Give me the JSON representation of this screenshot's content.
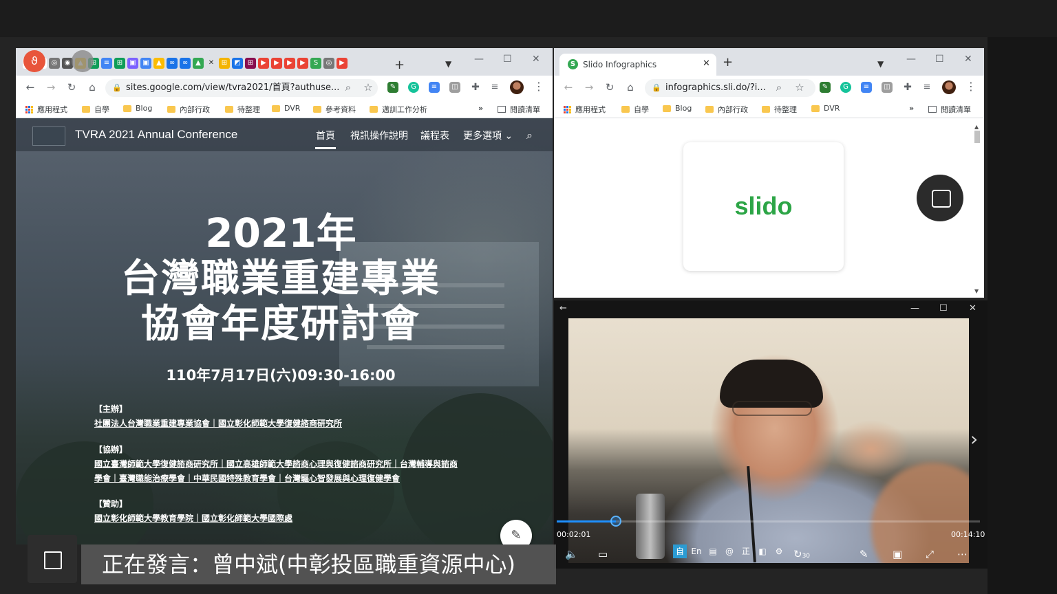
{
  "left_browser": {
    "address": "sites.google.com/view/tvra2021/首頁?authuse...",
    "bookmarks": [
      "應用程式",
      "自學",
      "Blog",
      "內部行政",
      "待整理",
      "DVR",
      "參考資料",
      "邁訓工作分析"
    ],
    "reading_list": "閱讀清單",
    "more": "»"
  },
  "site": {
    "title": "TVRA 2021 Annual Conference",
    "nav": [
      "首頁",
      "視訊操作說明",
      "議程表",
      "更多選項"
    ],
    "hero_year": "2021年",
    "hero_line2": "台灣職業重建專業",
    "hero_line3": "協會年度研討會",
    "date": "110年7月17日(六)09:30-16:00",
    "host_label": "【主辦】",
    "host": "社團法人台灣職業重建專業協會｜國立彰化師範大學復健諮商研究所",
    "co_label": "【協辦】",
    "co_line1": "國立臺灣師範大學復健諮商研究所｜國立高雄師範大學諮商心理與復健諮商研究所｜台灣輔導與諮商",
    "co_line2": "學會｜臺灣職能治療學會｜中華民國特殊教育學會｜台灣驅心智發展與心理復健學會",
    "sponsor_label": "【贊助】",
    "sponsor": "國立彰化師範大學教育學院｜國立彰化師範大學國際處"
  },
  "right_browser": {
    "tab_title": "Slido Infographics",
    "address": "infographics.sli.do/?i...",
    "bookmarks": [
      "應用程式",
      "自學",
      "Blog",
      "內部行政",
      "待整理",
      "DVR"
    ],
    "reading_list": "閱讀清單",
    "more": "»",
    "logo_text": "slido"
  },
  "player": {
    "elapsed": "00:02:01",
    "duration": "00:14:10",
    "progress": 0.14,
    "subtitle_buttons": [
      "自",
      "En",
      "▤",
      "@",
      "正",
      "◧",
      "⚙"
    ],
    "skip_label": "30"
  },
  "speaker_caption": "正在發言：曾中斌(中彰投區職重資源中心)"
}
